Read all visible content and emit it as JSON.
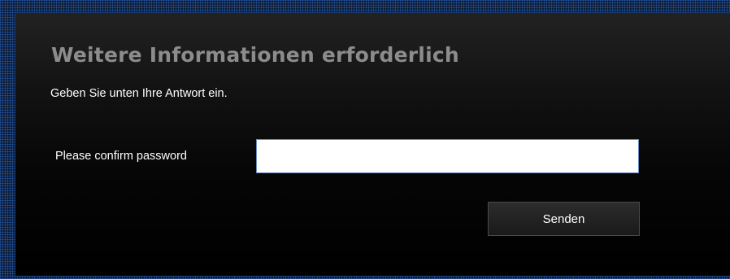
{
  "dialog": {
    "title": "Weitere Informationen erforderlich",
    "subtitle": "Geben Sie unten Ihre Antwort ein.",
    "field_label": "Please confirm password",
    "field_value": "",
    "submit_label": "Senden"
  },
  "colors": {
    "page_background": "#0b1a33",
    "panel_background": "#000000",
    "title_color": "#8c8c8c",
    "text_color": "#ffffff",
    "button_background": "#1f1f1f"
  }
}
